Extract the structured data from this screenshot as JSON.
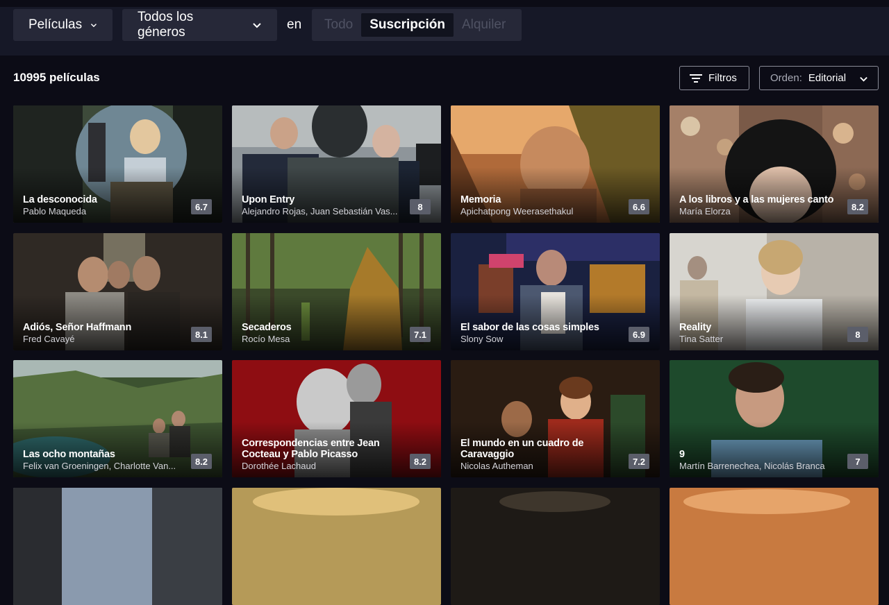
{
  "filters": {
    "type_label": "Películas",
    "genre_label": "Todos los géneros",
    "en_label": "en",
    "segments": [
      {
        "label": "Todo",
        "active": false
      },
      {
        "label": "Suscripción",
        "active": true
      },
      {
        "label": "Alquiler",
        "active": false
      }
    ]
  },
  "results": {
    "count_text": "10995 películas",
    "filters_button": "Filtros",
    "order_label": "Orden:",
    "order_value": "Editorial"
  },
  "movies": [
    {
      "title": "La desconocida",
      "director": "Pablo Maqueda",
      "rating": "6.7"
    },
    {
      "title": "Upon Entry",
      "director": "Alejandro Rojas, Juan Sebastián Vas...",
      "rating": "8"
    },
    {
      "title": "Memoria",
      "director": "Apichatpong Weerasethakul",
      "rating": "6.6"
    },
    {
      "title": "A los libros y a las mujeres canto",
      "director": "María Elorza",
      "rating": "8.2"
    },
    {
      "title": "Adiós, Señor Haffmann",
      "director": "Fred Cavayé",
      "rating": "8.1"
    },
    {
      "title": "Secaderos",
      "director": "Rocío Mesa",
      "rating": "7.1"
    },
    {
      "title": "El sabor de las cosas simples",
      "director": "Slony Sow",
      "rating": "6.9"
    },
    {
      "title": "Reality",
      "director": "Tina Satter",
      "rating": "8"
    },
    {
      "title": "Las ocho montañas",
      "director": "Felix van Groeningen, Charlotte Van...",
      "rating": "8.2"
    },
    {
      "title": "Correspondencias entre Jean Cocteau y Pablo Picasso",
      "director": "Dorothée Lachaud",
      "rating": "8.2"
    },
    {
      "title": "El mundo en un cuadro de Caravaggio",
      "director": "Nicolas Autheman",
      "rating": "7.2"
    },
    {
      "title": "9",
      "director": "Martín Barrenechea, Nicolás Branca",
      "rating": "7"
    }
  ],
  "colors": {
    "background": "#0c0c16",
    "filter_bar": "#161827",
    "control": "#262838",
    "rating_badge": "#5b5e6a"
  }
}
